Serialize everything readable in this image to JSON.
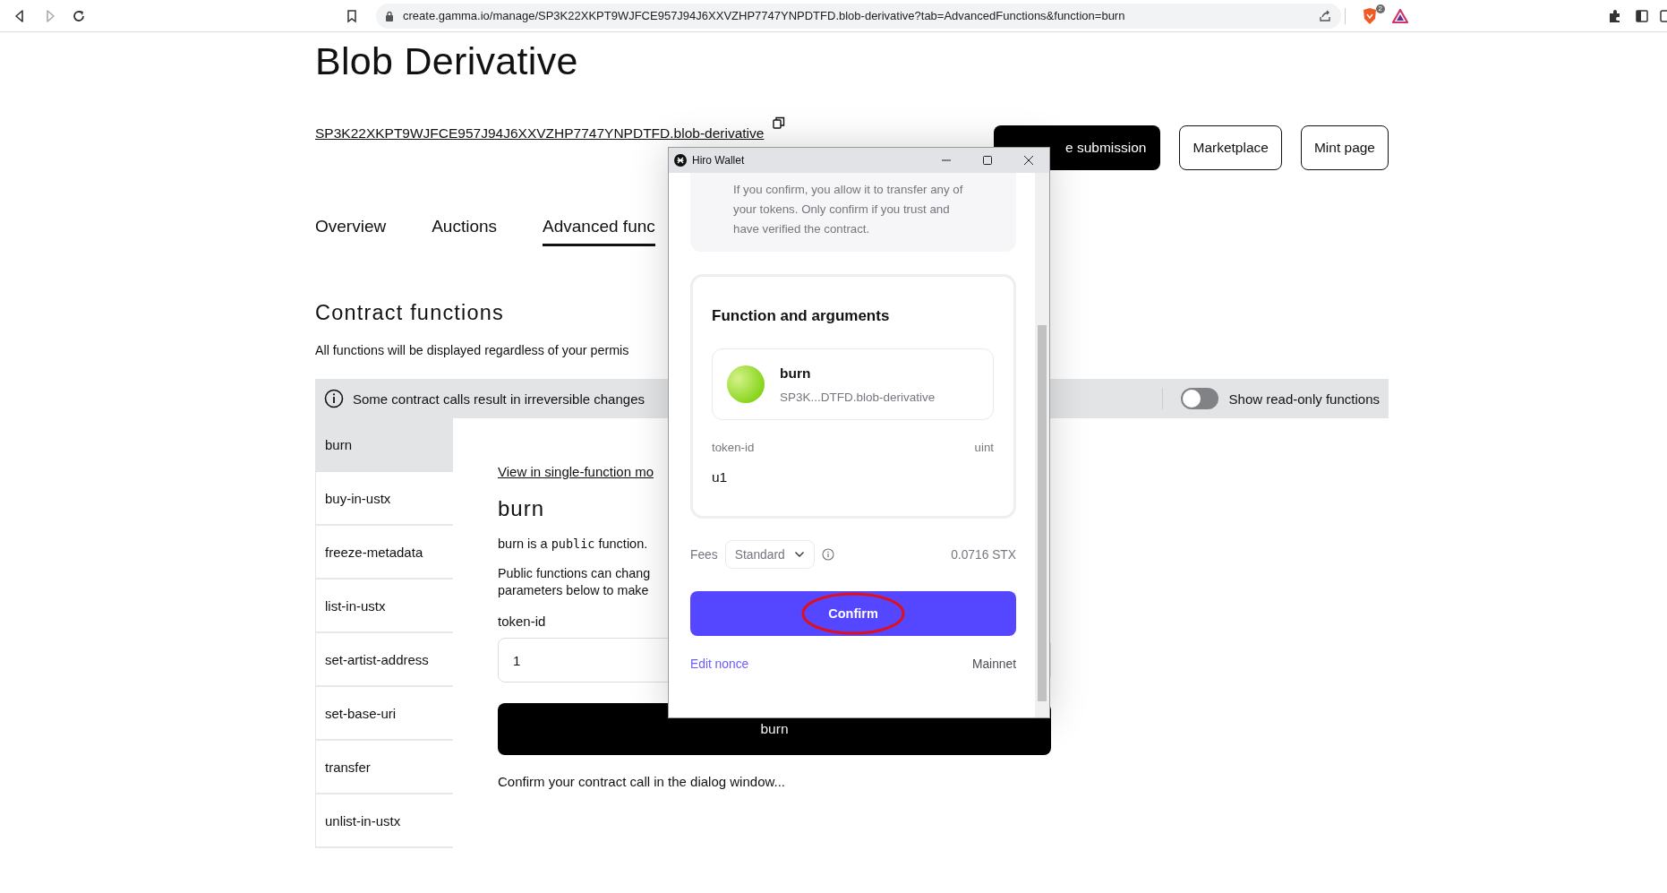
{
  "browser": {
    "url": "create.gamma.io/manage/SP3K22XKPT9WJFCE957J94J6XXVZHP7747YNPDTFD.blob-derivative?tab=AdvancedFunctions&function=burn",
    "shield_badge": "2"
  },
  "page": {
    "title": "Blob Derivative",
    "contract_link": "SP3K22XKPT9WJFCE957J94J6XXVZHP7747YNPDTFD.blob-derivative",
    "header_buttons": [
      {
        "label": "e submission",
        "kind": "primary"
      },
      {
        "label": "Marketplace",
        "kind": "outline"
      },
      {
        "label": "Mint page",
        "kind": "outline"
      }
    ],
    "tabs": [
      {
        "label": "Overview",
        "selected": false
      },
      {
        "label": "Auctions",
        "selected": false
      },
      {
        "label": "Advanced func",
        "selected": true
      }
    ],
    "section_title": "Contract functions",
    "section_note": "All functions will be displayed regardless of your permis",
    "notice": "Some contract calls result in irreversible changes",
    "read_only_toggle": {
      "label": "Show read-only functions",
      "on": false
    },
    "functions": [
      {
        "name": "burn",
        "selected": true
      },
      {
        "name": "buy-in-ustx",
        "selected": false
      },
      {
        "name": "freeze-metadata",
        "selected": false
      },
      {
        "name": "list-in-ustx",
        "selected": false
      },
      {
        "name": "set-artist-address",
        "selected": false
      },
      {
        "name": "set-base-uri",
        "selected": false
      },
      {
        "name": "transfer",
        "selected": false
      },
      {
        "name": "unlist-in-ustx",
        "selected": false
      }
    ],
    "detail": {
      "link": "View in single-function mo",
      "title": "burn",
      "summary_start": "burn is a ",
      "summary_code": "public",
      "summary_end": " function.",
      "description_lines": [
        "Public functions can chang",
        "parameters below to make"
      ],
      "arg_label": "token-id",
      "arg_value": "1",
      "submit": "burn",
      "status": "Confirm your contract call in the dialog window..."
    }
  },
  "wallet": {
    "title": "Hiro Wallet",
    "warning_lines": [
      "If you confirm, you allow it to transfer any of",
      "your tokens. Only confirm if you trust and",
      "have verified the contract."
    ],
    "section_title": "Function and arguments",
    "function_name": "burn",
    "contract": "SP3K...DTFD.blob-derivative",
    "arg_name": "token-id",
    "arg_type": "uint",
    "arg_value": "u1",
    "fees_label": "Fees",
    "fee_speed": "Standard",
    "fee_amount": "0.0716 STX",
    "confirm": "Confirm",
    "confirm_circled": true,
    "edit_nonce": "Edit nonce",
    "network": "Mainnet"
  }
}
